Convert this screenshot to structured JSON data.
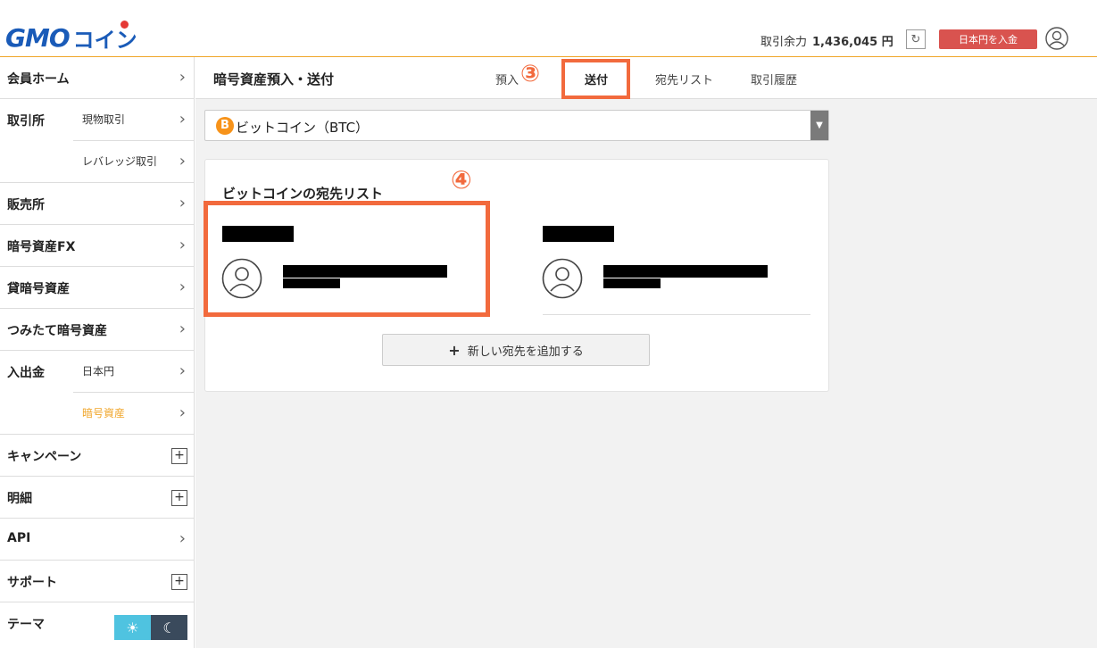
{
  "header": {
    "logo_gmo": "GMO",
    "logo_coin": "コイン",
    "balance_label": "取引余力",
    "balance_value": "1,436,045 円",
    "deposit_button": "日本円を入金",
    "refresh_icon": "refresh-icon",
    "user_icon": "user-icon"
  },
  "sidebar": {
    "items": [
      {
        "label": "会員ホーム",
        "control": "chevron"
      },
      {
        "label": "取引所",
        "control": "none"
      },
      {
        "label": "販売所",
        "control": "chevron"
      },
      {
        "label": "暗号資産FX",
        "control": "chevron"
      },
      {
        "label": "貸暗号資産",
        "control": "chevron"
      },
      {
        "label": "つみたて暗号資産",
        "control": "chevron"
      },
      {
        "label": "入出金",
        "control": "none"
      },
      {
        "label": "キャンペーン",
        "control": "plus"
      },
      {
        "label": "明細",
        "control": "plus"
      },
      {
        "label": "API",
        "control": "chevron"
      },
      {
        "label": "サポート",
        "control": "plus"
      },
      {
        "label": "テーマ",
        "control": "toggle"
      }
    ],
    "sub_items": {
      "torihikijo_1": "現物取引",
      "torihikijo_2": "レバレッジ取引",
      "nyushukkin_1": "日本円",
      "nyushukkin_2": "暗号資産"
    },
    "chevron": "›",
    "plus": "+"
  },
  "subheader": {
    "title": "暗号資産預入・送付",
    "tabs": [
      "預入",
      "送付",
      "宛先リスト",
      "取引履歴"
    ],
    "active_tab": "送付"
  },
  "annotations": {
    "step3": "③",
    "step4": "④"
  },
  "currency_select": {
    "icon_letter": "B",
    "value": "ビットコイン（BTC）"
  },
  "address_list": {
    "title": "ビットコインの宛先リスト",
    "add_button": "新しい宛先を追加する",
    "add_icon": "+"
  },
  "colors": {
    "accent": "#f0a62b",
    "annotation": "#f26a3d",
    "deposit_button": "#d9534f",
    "brand_blue": "#1a5bb8"
  }
}
